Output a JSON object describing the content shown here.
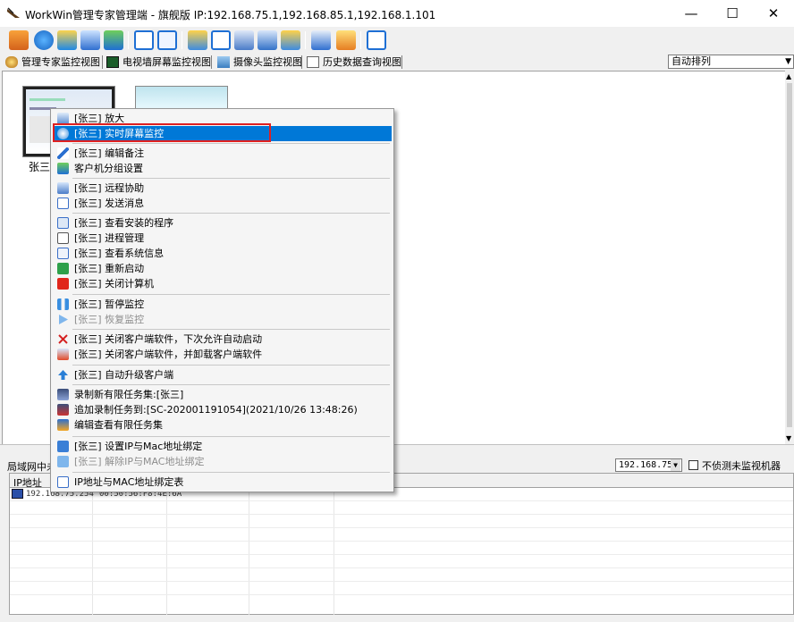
{
  "window": {
    "title": "WorkWin管理专家管理端 - 旗舰版 IP:192.168.75.1,192.168.85.1,192.168.1.101",
    "minimize": "—",
    "maximize": "☐",
    "close": "✕"
  },
  "tabs": [
    {
      "label": "管理专家监控视图",
      "icon": "manager-icon"
    },
    {
      "label": "电视墙屏幕监控视图",
      "icon": "tv-wall-icon"
    },
    {
      "label": "摄像头监控视图",
      "icon": "camera-icon"
    },
    {
      "label": "历史数据查询视图",
      "icon": "history-icon"
    }
  ],
  "sort_select": {
    "value": "自动排列"
  },
  "thumbnails": [
    {
      "label": "张三"
    }
  ],
  "lan_panel": {
    "title": "局域网中未",
    "ip_select": "192.168.75",
    "checkbox_label": "不侦测未监视机器",
    "columns": [
      "IP地址"
    ],
    "rows": [
      {
        "ip": "192.168.75.254",
        "mac": "00:50:56:F8:4E:6A"
      }
    ]
  },
  "context_menu": {
    "items": [
      {
        "label": "[张三] 放大",
        "icon": "zoom-icon",
        "enabled": true
      },
      {
        "label": "[张三] 实时屏幕监控",
        "icon": "realtime-monitor-icon",
        "enabled": true,
        "selected": true
      },
      {
        "label": "[张三] 编辑备注",
        "icon": "pencil-icon",
        "enabled": true
      },
      {
        "label": "客户机分组设置",
        "icon": "group-icon",
        "enabled": true
      },
      {
        "label": "[张三] 远程协助",
        "icon": "remote-assist-icon",
        "enabled": true
      },
      {
        "label": "[张三] 发送消息",
        "icon": "message-icon",
        "enabled": true
      },
      {
        "label": "[张三] 查看安装的程序",
        "icon": "programs-icon",
        "enabled": true
      },
      {
        "label": "[张三] 进程管理",
        "icon": "process-icon",
        "enabled": true
      },
      {
        "label": "[张三] 查看系统信息",
        "icon": "sysinfo-icon",
        "enabled": true
      },
      {
        "label": "[张三] 重新启动",
        "icon": "restart-icon",
        "enabled": true
      },
      {
        "label": "[张三] 关闭计算机",
        "icon": "power-icon",
        "enabled": true
      },
      {
        "label": "[张三] 暂停监控",
        "icon": "pause-icon",
        "enabled": true
      },
      {
        "label": "[张三] 恢复监控",
        "icon": "play-icon",
        "enabled": false
      },
      {
        "label": "[张三] 关闭客户端软件，下次允许自动启动",
        "icon": "close-x-icon",
        "enabled": true
      },
      {
        "label": "[张三] 关闭客户端软件，并卸载客户端软件",
        "icon": "uninstall-icon",
        "enabled": true
      },
      {
        "label": "[张三] 自动升级客户端",
        "icon": "upgrade-icon",
        "enabled": true
      },
      {
        "label": "录制新有限任务集:[张三]",
        "icon": "record-icon",
        "enabled": true
      },
      {
        "label": "追加录制任务到:[SC-202001191054](2021/10/26 13:48:26)",
        "icon": "append-record-icon",
        "enabled": true
      },
      {
        "label": "编辑查看有限任务集",
        "icon": "edit-task-icon",
        "enabled": true
      },
      {
        "label": "[张三] 设置IP与Mac地址绑定",
        "icon": "lock-icon",
        "enabled": true
      },
      {
        "label": "[张三] 解除IP与MAC地址绑定",
        "icon": "unlock-icon",
        "enabled": false
      },
      {
        "label": "IP地址与MAC地址绑定表",
        "icon": "table-icon",
        "enabled": true
      }
    ]
  },
  "colors": {
    "menu_selected": "#0078d7",
    "highlight_box": "#e02020"
  }
}
